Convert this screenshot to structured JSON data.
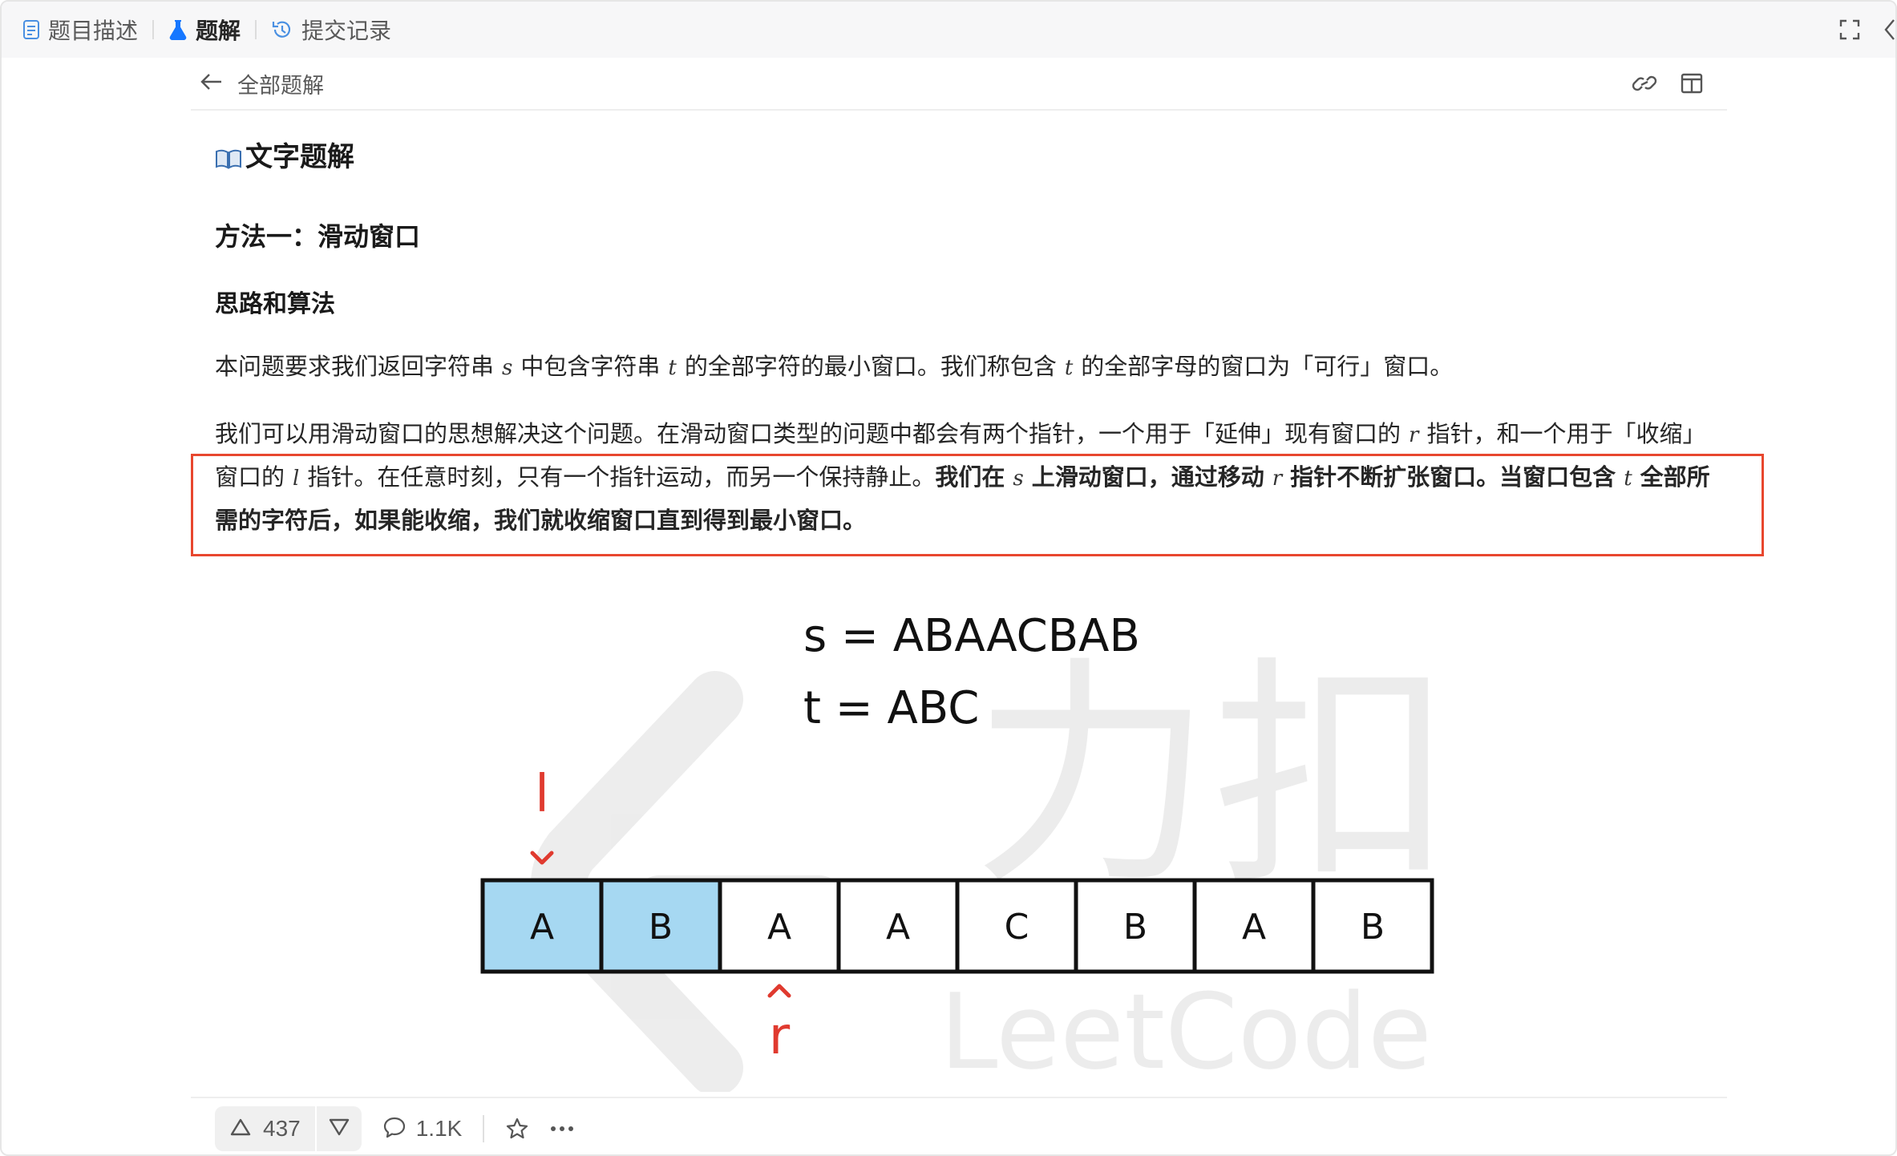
{
  "tabs": [
    {
      "label": "题目描述",
      "icon": "document-icon",
      "active": false
    },
    {
      "label": "题解",
      "icon": "flask-icon",
      "active": true
    },
    {
      "label": "提交记录",
      "icon": "history-icon",
      "active": false
    }
  ],
  "toolbar": {
    "back_label": "全部题解"
  },
  "article": {
    "title": "文字题解",
    "method_heading": "方法一：滑动窗口",
    "idea_heading": "思路和算法",
    "p1": {
      "a": "本问题要求我们返回字符串",
      "s": "s",
      "b": "中包含字符串",
      "t": "t",
      "c": "的全部字符的最小窗口。我们称包含",
      "t2": "t",
      "d": "的全部字母的窗口为「可行」窗口。"
    },
    "p2": {
      "a": "我们可以用滑动窗口的思想解决这个问题。在滑动窗口类型的问题中都会有两个指针，一个用于「延伸」现有窗口的",
      "r": "r",
      "b": "指针，和一个用于「收缩」窗口的",
      "l": "l",
      "c": "指针。在任意时刻，只有一个指针运动，而另一个保持静止。",
      "bold_a": "我们在",
      "s": "s",
      "bold_b": "上滑动窗口，通过移动",
      "r2": "r",
      "bold_c": "指针不断扩张窗口。当窗口包含",
      "t": "t",
      "bold_d": "全部所需的字符后，如果能收缩，我们就收缩窗口直到得到最小窗口。"
    }
  },
  "illustration": {
    "s_line": "s = ABAACBAB",
    "t_line": "t = ABC",
    "cells": [
      "A",
      "B",
      "A",
      "A",
      "C",
      "B",
      "A",
      "B"
    ],
    "highlighted_cells": [
      0,
      1
    ],
    "l_label": "l",
    "r_label": "r",
    "watermark_text": "LeetCode",
    "watermark_cn": "力扣",
    "colors": {
      "cell_fill": "#a6d8f2",
      "pointer": "#e03a2f",
      "highlight_box": "#e8472e"
    }
  },
  "footer": {
    "upvotes": "437",
    "comments": "1.1K"
  }
}
